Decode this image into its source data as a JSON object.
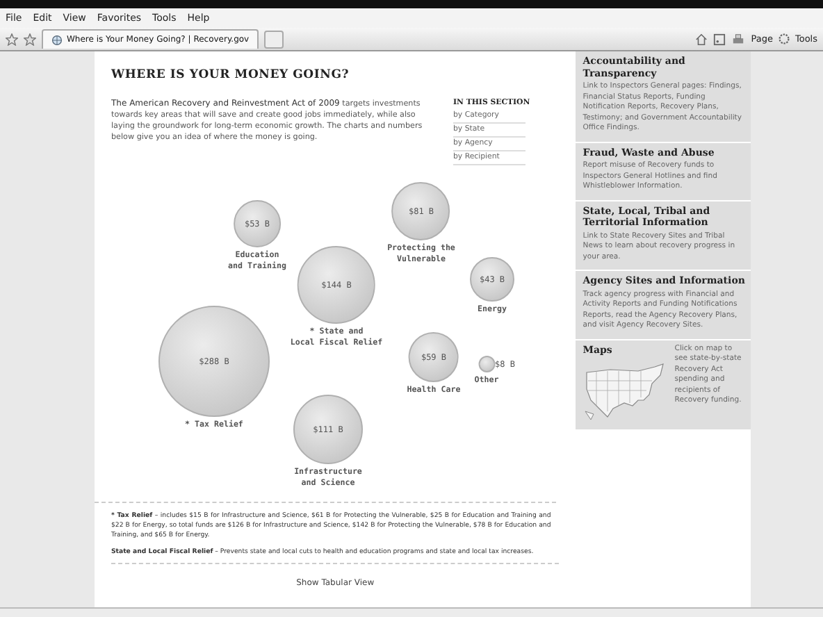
{
  "menu": [
    "File",
    "Edit",
    "View",
    "Favorites",
    "Tools",
    "Help"
  ],
  "tab": {
    "title": "Where is Your Money Going? | Recovery.gov"
  },
  "toolbar": {
    "page": "Page",
    "tools": "Tools"
  },
  "page": {
    "title": "WHERE IS YOUR MONEY GOING?",
    "intro_lead": "The American Recovery and Reinvestment Act of 2009",
    "intro_rest": " targets investments towards key areas that will save and create good jobs immediately, while also laying the groundwork for long-term economic growth. The charts and numbers below give you an idea of where the money is going.",
    "section": {
      "heading": "IN THIS SECTION",
      "links": [
        "by Category",
        "by State",
        "by Agency",
        "by Recipient"
      ]
    },
    "bubbles": [
      {
        "kind": "inside",
        "value": "$81 B",
        "label": "Protecting the\nVulnerable"
      },
      {
        "kind": "inside",
        "value": "$53 B",
        "label": "Education\nand Training"
      },
      {
        "kind": "inside",
        "value": "$43 B",
        "label": "Energy"
      },
      {
        "kind": "inside",
        "value": "$144 B",
        "label": "* State and\nLocal Fiscal Relief"
      },
      {
        "kind": "inside",
        "value": "$59 B",
        "label": "Health Care"
      },
      {
        "kind": "inside",
        "value": "$288 B",
        "label": "* Tax Relief"
      },
      {
        "kind": "outside",
        "value": "$8 B",
        "label": "Other"
      },
      {
        "kind": "inside",
        "value": "$111 B",
        "label": "Infrastructure\nand Science"
      }
    ],
    "footnotes": [
      {
        "term": "* Tax Relief",
        "text": " – includes $15 B for Infrastructure and Science, $61 B for Protecting the Vulnerable, $25 B for Education and Training and $22 B for Energy, so total funds are $126 B for Infrastructure and Science, $142 B for Protecting the Vulnerable, $78 B for Education and Training, and $65 B for Energy."
      },
      {
        "term": "State and Local Fiscal Relief",
        "text": " – Prevents state and local cuts to health and education programs and state and local tax increases."
      }
    ],
    "tabular_link": "Show Tabular View"
  },
  "sidebar": [
    {
      "kind": "text",
      "heading": "Accountability and Transparency",
      "text": "Link to Inspectors General pages: Findings, Financial Status Reports, Funding Notification Reports, Recovery Plans, Testimony; and Government Accountability Office Findings."
    },
    {
      "kind": "text",
      "heading": "Fraud, Waste and Abuse",
      "text": "Report misuse of Recovery funds to Inspectors General Hotlines and find Whistleblower Information."
    },
    {
      "kind": "text",
      "heading": "State, Local, Tribal and Territorial Information",
      "text": "Link to State Recovery Sites and Tribal News to learn about recovery progress in your area."
    },
    {
      "kind": "text",
      "heading": "Agency Sites and Information",
      "text": "Track agency progress with Financial and Activity Reports and Funding Notifications Reports, read the Agency Recovery Plans, and visit Agency Recovery Sites."
    },
    {
      "kind": "map",
      "heading": "Maps",
      "text": "Click on map to see state-by-state Recovery Act spending and recipients of Recovery funding."
    }
  ]
}
